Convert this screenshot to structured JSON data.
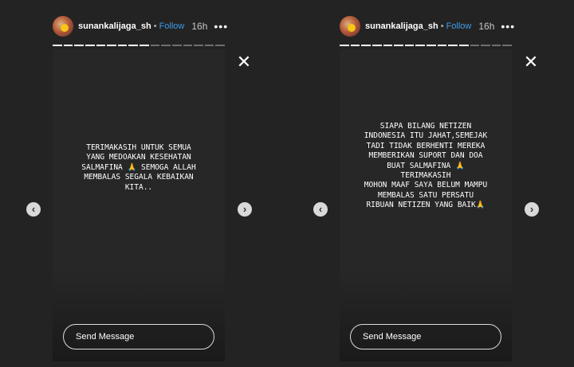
{
  "stories": [
    {
      "username": "sunankalijaga_sh",
      "separator": "•",
      "follow_label": "Follow",
      "time": "16h",
      "more_label": "•••",
      "close_label": "✕",
      "prev_label": "‹",
      "next_label": "›",
      "caption": "TERIMAKASIH UNTUK SEMUA\nYANG MEDOAKAN KESEHATAN\nSALMAFINA 🙏 SEMOGA ALLAH\nMEMBALAS SEGALA KEBAIKAN\nKITA..",
      "message_placeholder": "Send Message",
      "progress": {
        "segments": 16,
        "completed": 9
      }
    },
    {
      "username": "sunankalijaga_sh",
      "separator": "•",
      "follow_label": "Follow",
      "time": "16h",
      "more_label": "•••",
      "close_label": "✕",
      "prev_label": "‹",
      "next_label": "›",
      "caption": "SIAPA BILANG NETIZEN\nINDONESIA ITU JAHAT,SEMEJAK\nTADI TIDAK BERHENTI MEREKA\nMEMBERIKAN SUPORT DAN DOA\nBUAT SALMAFINA 🙏\nTERIMAKASIH\nMOHON MAAF SAYA BELUM MAMPU\nMEMBALAS SATU PERSATU\nRIBUAN NETIZEN YANG BAIK🙏",
      "message_placeholder": "Send Message",
      "progress": {
        "segments": 16,
        "completed": 12
      }
    }
  ],
  "icons": {
    "avatar": "avatar",
    "close": "close-icon",
    "prev": "chevron-left-icon",
    "next": "chevron-right-icon",
    "more": "more-icon"
  },
  "colors": {
    "background": "#232323",
    "story": "#272727",
    "follow": "#3d9be9",
    "progress_done": "#ffffff",
    "progress_pending": "rgba(255,255,255,0.35)"
  }
}
